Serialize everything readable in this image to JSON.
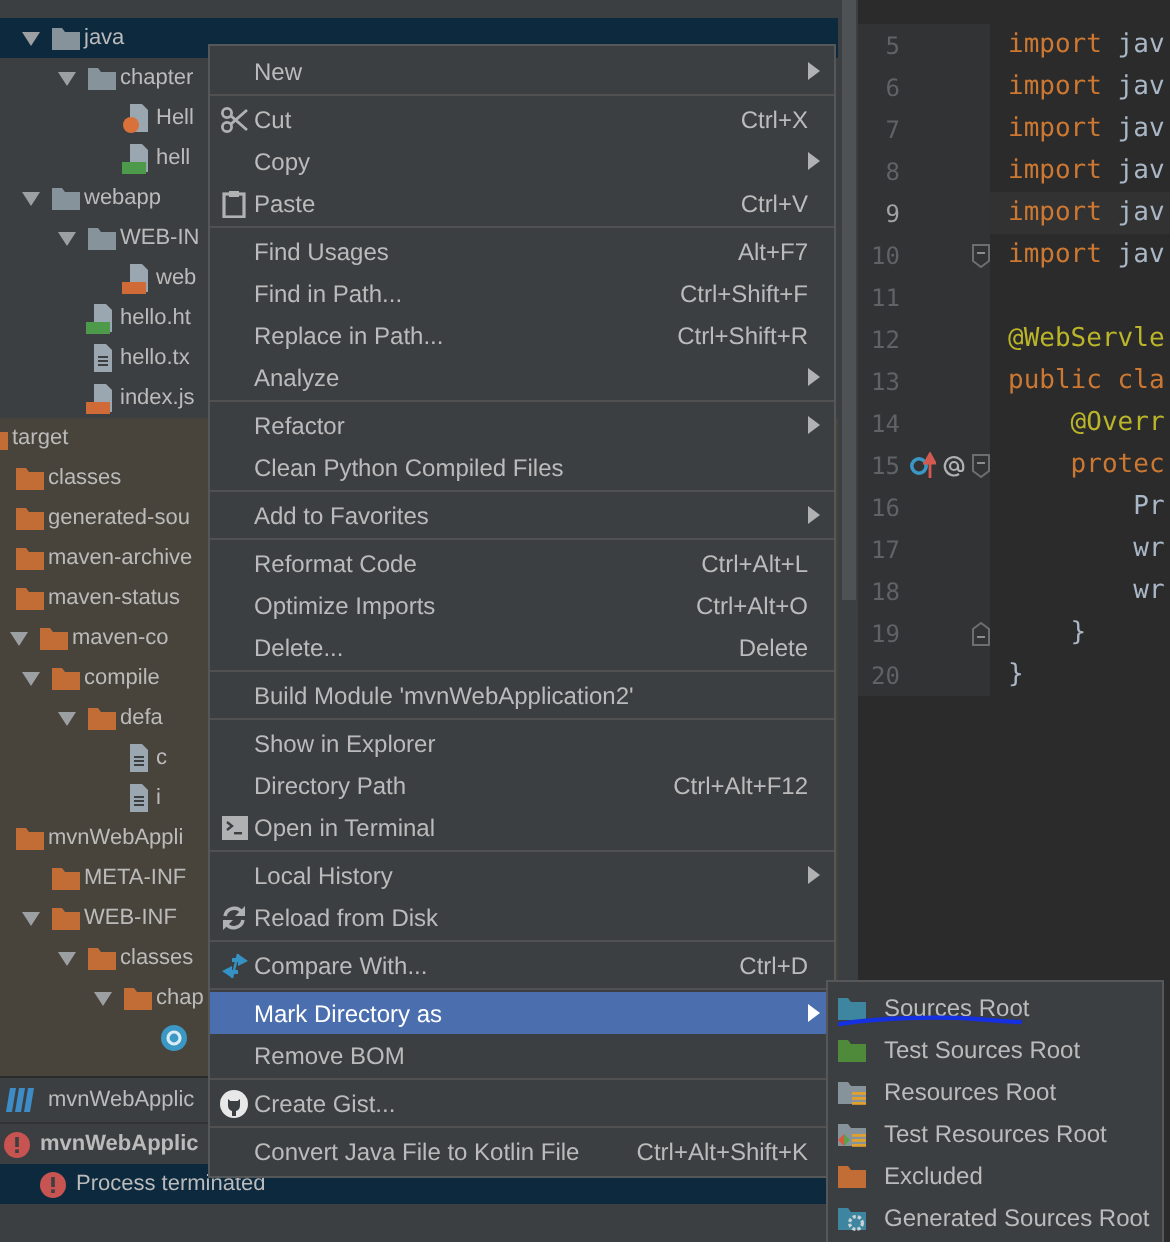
{
  "project_tree": {
    "sections": [
      {
        "excluded": false,
        "items": [
          {
            "children": [
              {
                "label": "java",
                "kind": "folder",
                "expanded": true,
                "selected": true,
                "children": [
                  {
                    "label": "chapter",
                    "kind": "folder",
                    "expanded": true,
                    "selected": false,
                    "children": [
                      {
                        "label": "Hell",
                        "kind": "java-file",
                        "selected": false
                      },
                      {
                        "label": "hell",
                        "kind": "html-file",
                        "selected": false
                      }
                    ]
                  }
                ]
              },
              {
                "label": "webapp",
                "kind": "folder",
                "expanded": true,
                "selected": false,
                "children": [
                  {
                    "label": "WEB-IN",
                    "kind": "folder",
                    "expanded": true,
                    "selected": false,
                    "children": [
                      {
                        "label": "web",
                        "kind": "xml-file",
                        "selected": false
                      }
                    ]
                  },
                  {
                    "label": "hello.ht",
                    "kind": "html-file",
                    "selected": false
                  },
                  {
                    "label": "hello.tx",
                    "kind": "text-file",
                    "selected": false
                  },
                  {
                    "label": "index.js",
                    "kind": "jsp-file",
                    "selected": false
                  }
                ]
              }
            ]
          }
        ]
      },
      {
        "excluded": true,
        "items": [
          {
            "label": "target",
            "kind": "excluded-folder",
            "selected": false,
            "children": [
              {
                "label": "classes",
                "kind": "excluded-folder",
                "selected": false
              },
              {
                "label": "generated-sou",
                "kind": "excluded-folder",
                "selected": false
              },
              {
                "label": "maven-archive",
                "kind": "excluded-folder",
                "selected": false
              },
              {
                "label": "maven-status",
                "kind": "excluded-folder",
                "selected": false
              },
              {
                "label": "maven-co",
                "kind": "excluded-folder",
                "expanded": true,
                "selected": false,
                "children": [
                  {
                    "label": "compile",
                    "kind": "excluded-folder",
                    "expanded": true,
                    "selected": false,
                    "children": [
                      {
                        "label": "defa",
                        "kind": "excluded-folder",
                        "expanded": true,
                        "selected": false,
                        "children": [
                          {
                            "label": "c",
                            "kind": "text-file",
                            "selected": false
                          },
                          {
                            "label": "i",
                            "kind": "text-file",
                            "selected": false
                          }
                        ]
                      }
                    ]
                  }
                ]
              },
              {
                "label": "mvnWebAppli",
                "kind": "excluded-folder",
                "selected": false,
                "children": [
                  {
                    "label": "META-INF",
                    "kind": "excluded-folder",
                    "selected": false
                  },
                  {
                    "label": "WEB-INF",
                    "kind": "excluded-folder",
                    "expanded": true,
                    "selected": false,
                    "children": [
                      {
                        "label": "classes",
                        "kind": "excluded-folder",
                        "expanded": true,
                        "selected": false,
                        "children": [
                          {
                            "label": "chap",
                            "kind": "excluded-folder",
                            "expanded": true,
                            "selected": false,
                            "children": [
                              {
                                "kind": "class-file",
                                "selected": false
                              }
                            ]
                          }
                        ]
                      }
                    ]
                  }
                ]
              }
            ]
          }
        ]
      }
    ]
  },
  "run_panel": {
    "tab": {
      "label": "mvnWebApplic"
    },
    "items": [
      {
        "label": "mvnWebApplic",
        "kind": "error",
        "selected": false,
        "children": [
          {
            "label": "Process terminated",
            "kind": "error",
            "selected": true
          }
        ]
      }
    ]
  },
  "editor": {
    "lines": [
      {
        "number": "5",
        "current": false,
        "tokens": [
          {
            "text": "import",
            "kind": "keyword"
          },
          {
            "text": " jav",
            "kind": "plain"
          }
        ]
      },
      {
        "number": "6",
        "current": false,
        "tokens": [
          {
            "text": "import",
            "kind": "keyword"
          },
          {
            "text": " jav",
            "kind": "plain"
          }
        ]
      },
      {
        "number": "7",
        "current": false,
        "tokens": [
          {
            "text": "import",
            "kind": "keyword"
          },
          {
            "text": " jav",
            "kind": "plain"
          }
        ]
      },
      {
        "number": "8",
        "current": false,
        "tokens": [
          {
            "text": "import",
            "kind": "keyword"
          },
          {
            "text": " jav",
            "kind": "plain"
          }
        ]
      },
      {
        "number": "9",
        "current": true,
        "tokens": [
          {
            "text": "import",
            "kind": "keyword"
          },
          {
            "text": " jav",
            "kind": "plain"
          }
        ]
      },
      {
        "number": "10",
        "current": false,
        "gutter_marks": [
          {
            "kind": "fold-start"
          }
        ],
        "tokens": [
          {
            "text": "import",
            "kind": "keyword"
          },
          {
            "text": " jav",
            "kind": "plain"
          }
        ]
      },
      {
        "number": "11",
        "current": false
      },
      {
        "number": "12",
        "current": false,
        "tokens": [
          {
            "text": "@WebServle",
            "kind": "annotation"
          }
        ]
      },
      {
        "number": "13",
        "current": false,
        "tokens": [
          {
            "text": "public cla",
            "kind": "keyword"
          }
        ]
      },
      {
        "number": "14",
        "current": false,
        "tokens": [
          {
            "text": "    @Overr",
            "kind": "annotation"
          }
        ]
      },
      {
        "number": "15",
        "current": false,
        "gutter_marks": [
          {
            "kind": "override"
          },
          {
            "kind": "annotation"
          },
          {
            "kind": "fold-start"
          }
        ],
        "tokens": [
          {
            "text": "    protec",
            "kind": "keyword"
          }
        ]
      },
      {
        "number": "16",
        "current": false,
        "tokens": [
          {
            "text": "        Pr",
            "kind": "plain"
          }
        ]
      },
      {
        "number": "17",
        "current": false,
        "tokens": [
          {
            "text": "        wr",
            "kind": "plain"
          }
        ]
      },
      {
        "number": "18",
        "current": false,
        "tokens": [
          {
            "text": "        wr",
            "kind": "plain"
          }
        ]
      },
      {
        "number": "19",
        "current": false,
        "gutter_marks": [
          {
            "kind": "fold-end"
          }
        ],
        "tokens": [
          {
            "text": "    }",
            "kind": "plain"
          }
        ]
      },
      {
        "number": "20",
        "current": false,
        "tokens": [
          {
            "text": "}",
            "kind": "plain"
          }
        ]
      }
    ]
  },
  "context_menu": {
    "groups": [
      [
        {
          "label": "New",
          "submenu": true,
          "selected": false
        }
      ],
      [
        {
          "label": "Cut",
          "kind": "scissors",
          "shortcut": "Ctrl+X",
          "submenu": false,
          "selected": false
        },
        {
          "label": "Copy",
          "submenu": true,
          "selected": false
        },
        {
          "label": "Paste",
          "kind": "clipboard",
          "shortcut": "Ctrl+V",
          "submenu": false,
          "selected": false
        }
      ],
      [
        {
          "label": "Find Usages",
          "shortcut": "Alt+F7",
          "submenu": false,
          "selected": false
        },
        {
          "label": "Find in Path...",
          "shortcut": "Ctrl+Shift+F",
          "submenu": false,
          "selected": false
        },
        {
          "label": "Replace in Path...",
          "shortcut": "Ctrl+Shift+R",
          "submenu": false,
          "selected": false
        },
        {
          "label": "Analyze",
          "submenu": true,
          "selected": false
        }
      ],
      [
        {
          "label": "Refactor",
          "submenu": true,
          "selected": false
        },
        {
          "label": "Clean Python Compiled Files",
          "submenu": false,
          "selected": false
        }
      ],
      [
        {
          "label": "Add to Favorites",
          "submenu": true,
          "selected": false
        }
      ],
      [
        {
          "label": "Reformat Code",
          "shortcut": "Ctrl+Alt+L",
          "submenu": false,
          "selected": false
        },
        {
          "label": "Optimize Imports",
          "shortcut": "Ctrl+Alt+O",
          "submenu": false,
          "selected": false
        },
        {
          "label": "Delete...",
          "shortcut": "Delete",
          "submenu": false,
          "selected": false
        }
      ],
      [
        {
          "label": "Build Module 'mvnWebApplication2'",
          "submenu": false,
          "selected": false
        }
      ],
      [
        {
          "label": "Show in Explorer",
          "submenu": false,
          "selected": false
        },
        {
          "label": "Directory Path",
          "shortcut": "Ctrl+Alt+F12",
          "submenu": false,
          "selected": false
        },
        {
          "label": "Open in Terminal",
          "kind": "terminal",
          "submenu": false,
          "selected": false
        }
      ],
      [
        {
          "label": "Local History",
          "submenu": true,
          "selected": false
        },
        {
          "label": "Reload from Disk",
          "kind": "reload",
          "submenu": false,
          "selected": false
        }
      ],
      [
        {
          "label": "Compare With...",
          "kind": "compare",
          "shortcut": "Ctrl+D",
          "submenu": false,
          "selected": false
        }
      ],
      [
        {
          "label": "Mark Directory as",
          "submenu": true,
          "selected": true
        },
        {
          "label": "Remove BOM",
          "submenu": false,
          "selected": false
        }
      ],
      [
        {
          "label": "Create Gist...",
          "kind": "cat-logo",
          "submenu": false,
          "selected": false
        }
      ],
      [
        {
          "label": "Convert Java File to Kotlin File",
          "shortcut": "Ctrl+Alt+Shift+K",
          "submenu": false,
          "selected": false
        }
      ]
    ]
  },
  "mark_directory_submenu": {
    "items": [
      {
        "label": "Sources Root",
        "kind": "source-folder",
        "selected": false
      },
      {
        "label": "Test Sources Root",
        "kind": "test-folder",
        "selected": false
      },
      {
        "label": "Resources Root",
        "kind": "resource-folder",
        "selected": false
      },
      {
        "label": "Test Resources Root",
        "kind": "test-resource-folder",
        "selected": false
      },
      {
        "label": "Excluded",
        "kind": "excluded-folder",
        "selected": false
      },
      {
        "label": "Generated Sources Root",
        "kind": "generated-folder",
        "selected": false
      }
    ]
  }
}
